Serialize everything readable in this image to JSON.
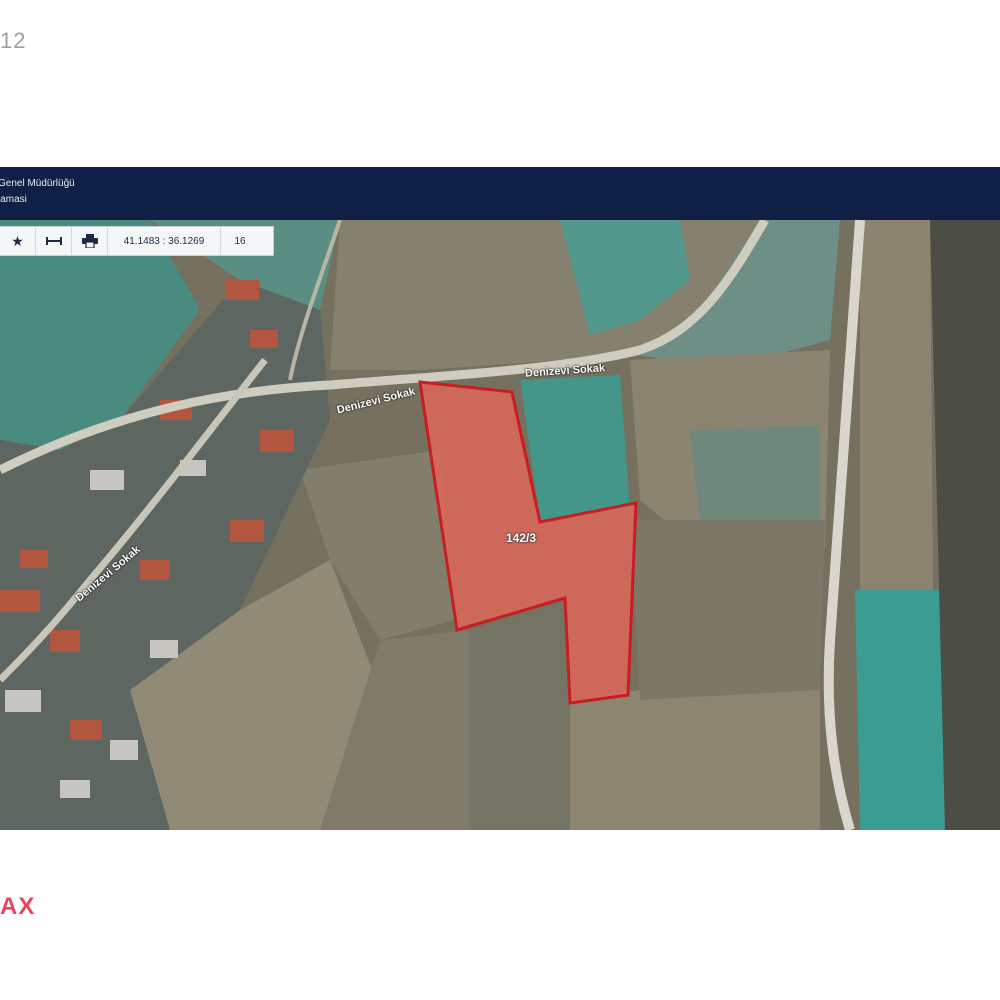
{
  "corner": {
    "top_text": "12",
    "bottom_text": "AX"
  },
  "header": {
    "line1": "Genel Müdürlüğü",
    "line2": "lamasi"
  },
  "toolbar": {
    "coordinates": "41.1483 : 36.1269",
    "zoom": "16",
    "icons": [
      "star-icon",
      "measure-icon",
      "print-icon"
    ]
  },
  "map": {
    "road_label_1": "Denizevi Sokak",
    "road_label_2": "Denizevi Sokak",
    "road_label_3": "Denizevi Sokak",
    "parcel_label": "142/3",
    "colors": {
      "parcel_fill": "#e0665a",
      "parcel_stroke": "#c81e22"
    }
  }
}
